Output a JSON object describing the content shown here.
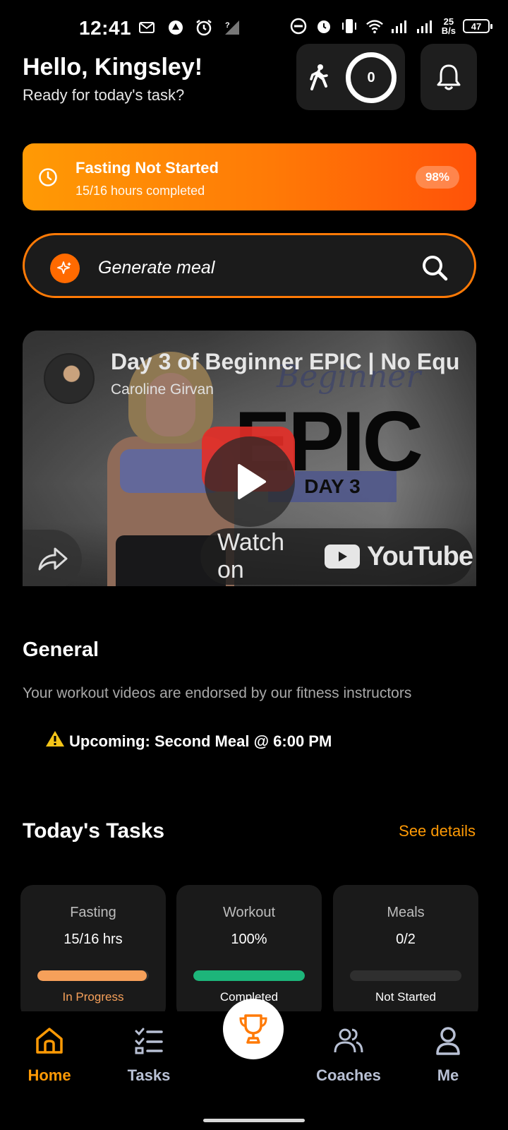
{
  "status_bar": {
    "time": "12:41",
    "net_speed_value": "25",
    "net_speed_unit": "B/s",
    "battery": "47"
  },
  "header": {
    "greeting": "Hello, Kingsley!",
    "subtitle": "Ready for today's task?",
    "steps": "0"
  },
  "fasting_banner": {
    "title": "Fasting Not Started",
    "subtitle": "15/16 hours completed",
    "percent": "98%"
  },
  "meal_search": {
    "label": "Generate meal"
  },
  "video": {
    "title": "Day 3 of Beginner EPIC | No Equ",
    "channel": "Caroline Girvan",
    "thumb_script": "Beginner",
    "thumb_title": "EPIC",
    "thumb_day": "DAY 3",
    "watch_on": "Watch on",
    "youtube": "YouTube"
  },
  "general": {
    "title": "General",
    "description": "Your workout videos are endorsed by our fitness instructors",
    "upcoming": "Upcoming: Second Meal @ 6:00 PM"
  },
  "tasks": {
    "title": "Today's Tasks",
    "see_details": "See details",
    "items": [
      {
        "name": "Fasting",
        "value": "15/16 hrs",
        "status": "In Progress",
        "progress": 0.98,
        "color": "#f6a05a",
        "status_color": "#f6a05a"
      },
      {
        "name": "Workout",
        "value": "100%",
        "status": "Completed",
        "progress": 1.0,
        "color": "#1db57a",
        "status_color": "#ffffff"
      },
      {
        "name": "Meals",
        "value": "0/2",
        "status": "Not Started",
        "progress": 0.0,
        "color": "#2f2f2f",
        "status_color": "#ffffff"
      }
    ]
  },
  "nav": {
    "items": [
      {
        "label": "Home",
        "icon": "home-icon",
        "active": true
      },
      {
        "label": "Tasks",
        "icon": "tasks-icon",
        "active": false
      },
      {
        "label": "",
        "icon": "trophy-icon",
        "active": false
      },
      {
        "label": "Coaches",
        "icon": "coaches-icon",
        "active": false
      },
      {
        "label": "Me",
        "icon": "profile-icon",
        "active": false
      }
    ],
    "active_color": "#ff9a05",
    "inactive_color": "#b8c0d4"
  },
  "colors": {
    "accent": "#ff7a06",
    "background": "#000000",
    "card": "#1a1a1a"
  }
}
